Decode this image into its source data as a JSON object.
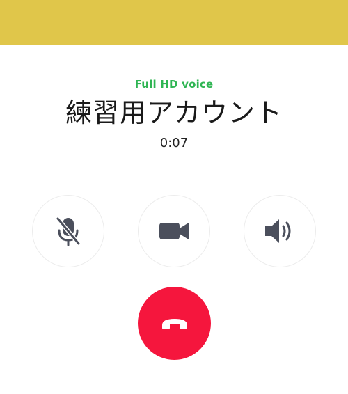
{
  "call": {
    "quality_label": "Full HD voice",
    "contact_name": "練習用アカウント",
    "elapsed_time": "0:07"
  },
  "controls": {
    "mute": {
      "icon": "microphone-muted-icon",
      "state": "muted"
    },
    "video": {
      "icon": "video-camera-icon"
    },
    "speaker": {
      "icon": "speaker-icon"
    },
    "end_call": {
      "icon": "hang-up-phone-icon"
    }
  },
  "colors": {
    "top_bar": "#e0c64a",
    "hd_label": "#2fb553",
    "end_call": "#f5163d",
    "icon": "#4b4f5c"
  }
}
